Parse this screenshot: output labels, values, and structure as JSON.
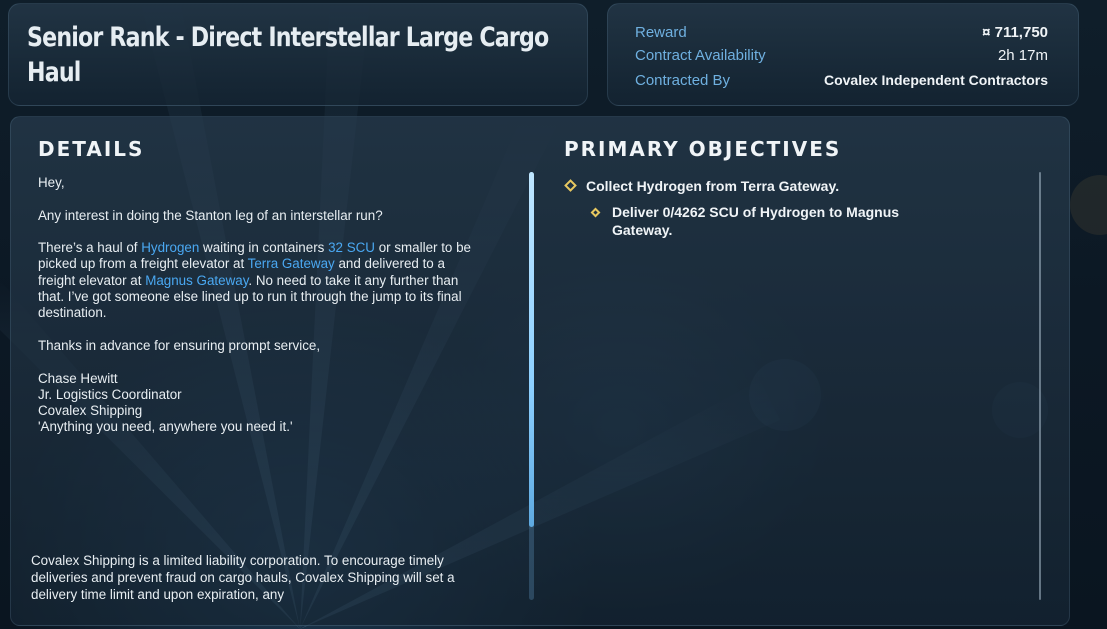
{
  "contract": {
    "title": "Senior Rank - Direct Interstellar Large Cargo Haul"
  },
  "info": {
    "reward_label": "Reward",
    "reward_value": "¤ 711,750",
    "availability_label": "Contract Availability",
    "availability_value": "2h 17m",
    "contracted_by_label": "Contracted By",
    "contracted_by_value": "Covalex Independent Contractors"
  },
  "details": {
    "heading": "DETAILS",
    "greeting": "Hey,",
    "question": "Any interest in doing the Stanton leg of an interstellar run?",
    "para_parts": [
      "There’s a haul of ",
      "Hydrogen",
      " waiting in containers ",
      "32 SCU",
      " or smaller to be picked up from a freight elevator at ",
      "Terra Gateway",
      " and delivered to a freight elevator at ",
      "Magnus Gateway",
      ". No need to take it any further than that. I’ve got someone else lined up to run it through the jump to its final destination."
    ],
    "thanks": "Thanks in advance for ensuring prompt service,",
    "signature": {
      "name": "Chase Hewitt",
      "role": "Jr. Logistics Coordinator",
      "company": "Covalex Shipping",
      "motto": "'Anything you need, anywhere you need it.'"
    },
    "footer": "Covalex Shipping is a limited liability corporation. To encourage timely deliveries and prevent fraud on cargo hauls, Covalex Shipping will set a delivery time limit and upon expiration, any"
  },
  "objectives": {
    "heading": "PRIMARY OBJECTIVES",
    "primary": "Collect Hydrogen from Terra Gateway.",
    "sub": "Deliver 0/4262 SCU of Hydrogen to Magnus Gateway."
  },
  "colors": {
    "accent": "#4aa8f2",
    "objective_marker": "#e8c860",
    "label": "#6fb0e0"
  }
}
